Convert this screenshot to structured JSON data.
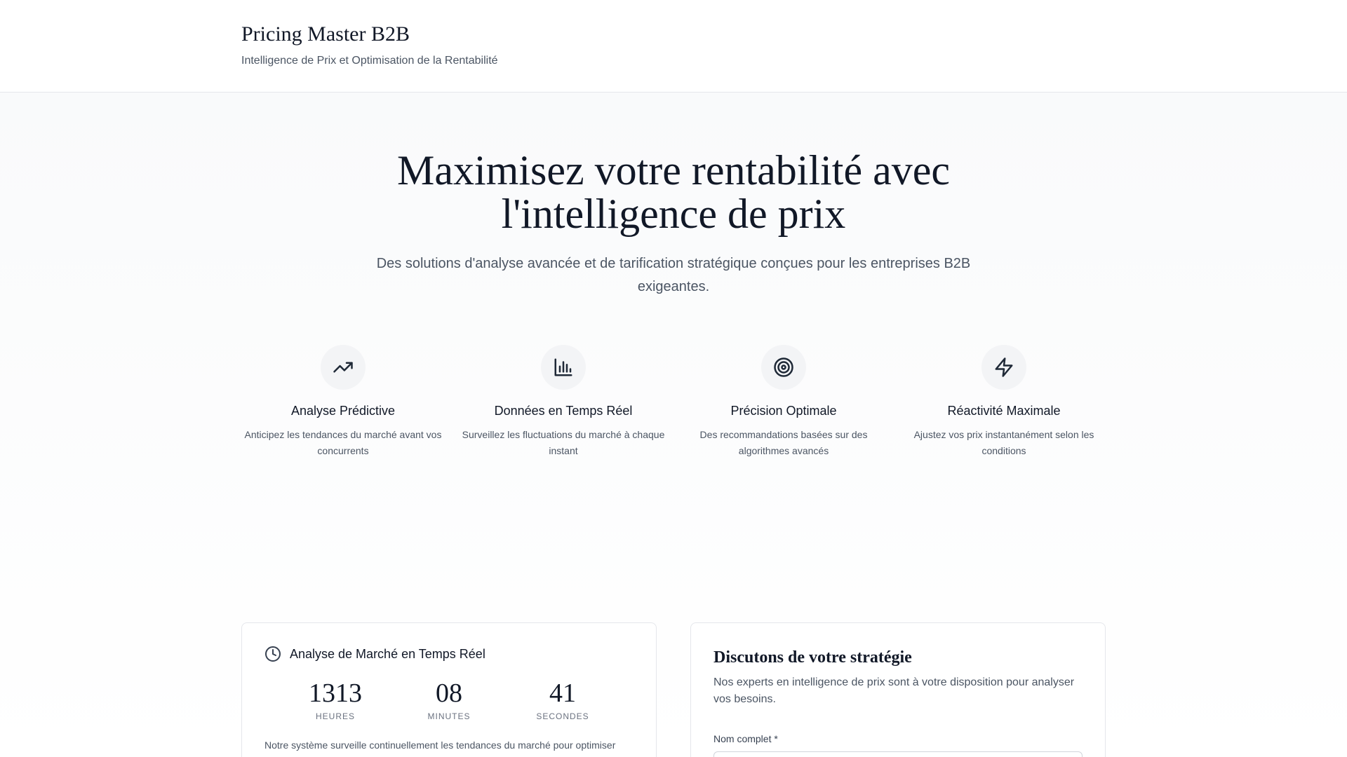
{
  "header": {
    "title": "Pricing Master B2B",
    "subtitle": "Intelligence de Prix et Optimisation de la Rentabilité"
  },
  "hero": {
    "title_line1": "Maximisez votre rentabilité avec",
    "title_line2": "l'intelligence de prix",
    "subtitle": "Des solutions d'analyse avancée et de tarification stratégique conçues pour les entreprises B2B exigeantes."
  },
  "features": [
    {
      "icon": "trending-up-icon",
      "title": "Analyse Prédictive",
      "desc": "Anticipez les tendances du marché avant vos concurrents"
    },
    {
      "icon": "bar-chart-icon",
      "title": "Données en Temps Réel",
      "desc": "Surveillez les fluctuations du marché à chaque instant"
    },
    {
      "icon": "target-icon",
      "title": "Précision Optimale",
      "desc": "Des recommandations basées sur des algorithmes avancés"
    },
    {
      "icon": "lightning-icon",
      "title": "Réactivité Maximale",
      "desc": "Ajustez vos prix instantanément selon les conditions"
    }
  ],
  "market": {
    "title": "Analyse de Marché en Temps Réel",
    "hours": "1313",
    "hours_label": "HEURES",
    "minutes": "08",
    "minutes_label": "MINUTES",
    "seconds": "41",
    "seconds_label": "SECONDES",
    "note": "Notre système surveille continuellement les tendances du marché pour optimiser"
  },
  "contact": {
    "title": "Discutons de votre stratégie",
    "subtitle": "Nos experts en intelligence de prix sont à votre disposition pour analyser vos besoins.",
    "name_label": "Nom complet *",
    "name_value": ""
  }
}
